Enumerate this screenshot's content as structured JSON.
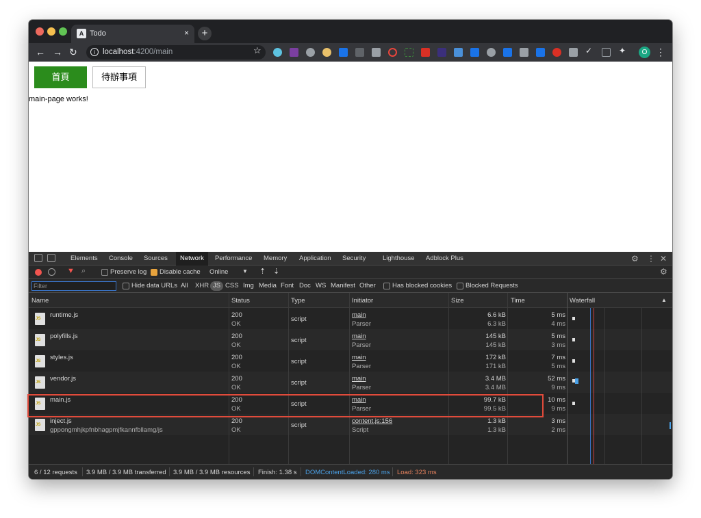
{
  "browser": {
    "tab_title": "Todo",
    "tab_favicon": "A",
    "tab_close": "×",
    "new_tab": "+",
    "url_host": "localhost",
    "url_rest": ":4200/main",
    "profile_initial": "O"
  },
  "page": {
    "home_button": "首頁",
    "todo_button": "待辦事項",
    "body_text": "main-page works!"
  },
  "devtools": {
    "tabs": [
      "Elements",
      "Console",
      "Sources",
      "Network",
      "Performance",
      "Memory",
      "Application",
      "Security",
      "Lighthouse",
      "Adblock Plus"
    ],
    "active_tab": "Network",
    "toolbar": {
      "preserve_log": "Preserve log",
      "disable_cache": "Disable cache",
      "throttle": "Online"
    },
    "filterbar": {
      "placeholder": "Filter",
      "hide_data_urls": "Hide data URLs",
      "types": [
        "All",
        "XHR",
        "JS",
        "CSS",
        "Img",
        "Media",
        "Font",
        "Doc",
        "WS",
        "Manifest",
        "Other"
      ],
      "selected_type": "JS",
      "has_blocked_cookies": "Has blocked cookies",
      "blocked_requests": "Blocked Requests"
    },
    "columns": [
      "Name",
      "Status",
      "Type",
      "Initiator",
      "Size",
      "Time",
      "Waterfall"
    ],
    "rows": [
      {
        "name": "runtime.js",
        "subname": "",
        "status": "200",
        "status_text": "OK",
        "type": "script",
        "initiator": "main",
        "initiator_sub": "Parser",
        "size": "6.6 kB",
        "size_sub": "6.3 kB",
        "time": "5 ms",
        "time_sub": "4 ms"
      },
      {
        "name": "polyfills.js",
        "subname": "",
        "status": "200",
        "status_text": "OK",
        "type": "script",
        "initiator": "main",
        "initiator_sub": "Parser",
        "size": "145 kB",
        "size_sub": "145 kB",
        "time": "5 ms",
        "time_sub": "3 ms"
      },
      {
        "name": "styles.js",
        "subname": "",
        "status": "200",
        "status_text": "OK",
        "type": "script",
        "initiator": "main",
        "initiator_sub": "Parser",
        "size": "172 kB",
        "size_sub": "171 kB",
        "time": "7 ms",
        "time_sub": "5 ms"
      },
      {
        "name": "vendor.js",
        "subname": "",
        "status": "200",
        "status_text": "OK",
        "type": "script",
        "initiator": "main",
        "initiator_sub": "Parser",
        "size": "3.4 MB",
        "size_sub": "3.4 MB",
        "time": "52 ms",
        "time_sub": "9 ms"
      },
      {
        "name": "main.js",
        "subname": "",
        "status": "200",
        "status_text": "OK",
        "type": "script",
        "initiator": "main",
        "initiator_sub": "Parser",
        "size": "99.7 kB",
        "size_sub": "99.5 kB",
        "time": "10 ms",
        "time_sub": "9 ms"
      },
      {
        "name": "inject.js",
        "subname": "gppongmhjkpfnbhagpmjfkannfbllamg/js",
        "status": "200",
        "status_text": "OK",
        "type": "script",
        "initiator": "content.js:156",
        "initiator_sub": "Script",
        "size": "1.3 kB",
        "size_sub": "1.3 kB",
        "time": "3 ms",
        "time_sub": "2 ms"
      }
    ],
    "status_bar": {
      "requests": "6 / 12 requests",
      "transferred": "3.9 MB / 3.9 MB transferred",
      "resources": "3.9 MB / 3.9 MB resources",
      "finish": "Finish: 1.38 s",
      "dom_content_loaded": "DOMContentLoaded: 280 ms",
      "load": "Load: 323 ms"
    }
  },
  "colors": {
    "home_button_bg": "#2b8c1c",
    "highlight_border": "#e14b3b",
    "dcl_text": "#4aa0e6",
    "load_text": "#e8835e"
  }
}
